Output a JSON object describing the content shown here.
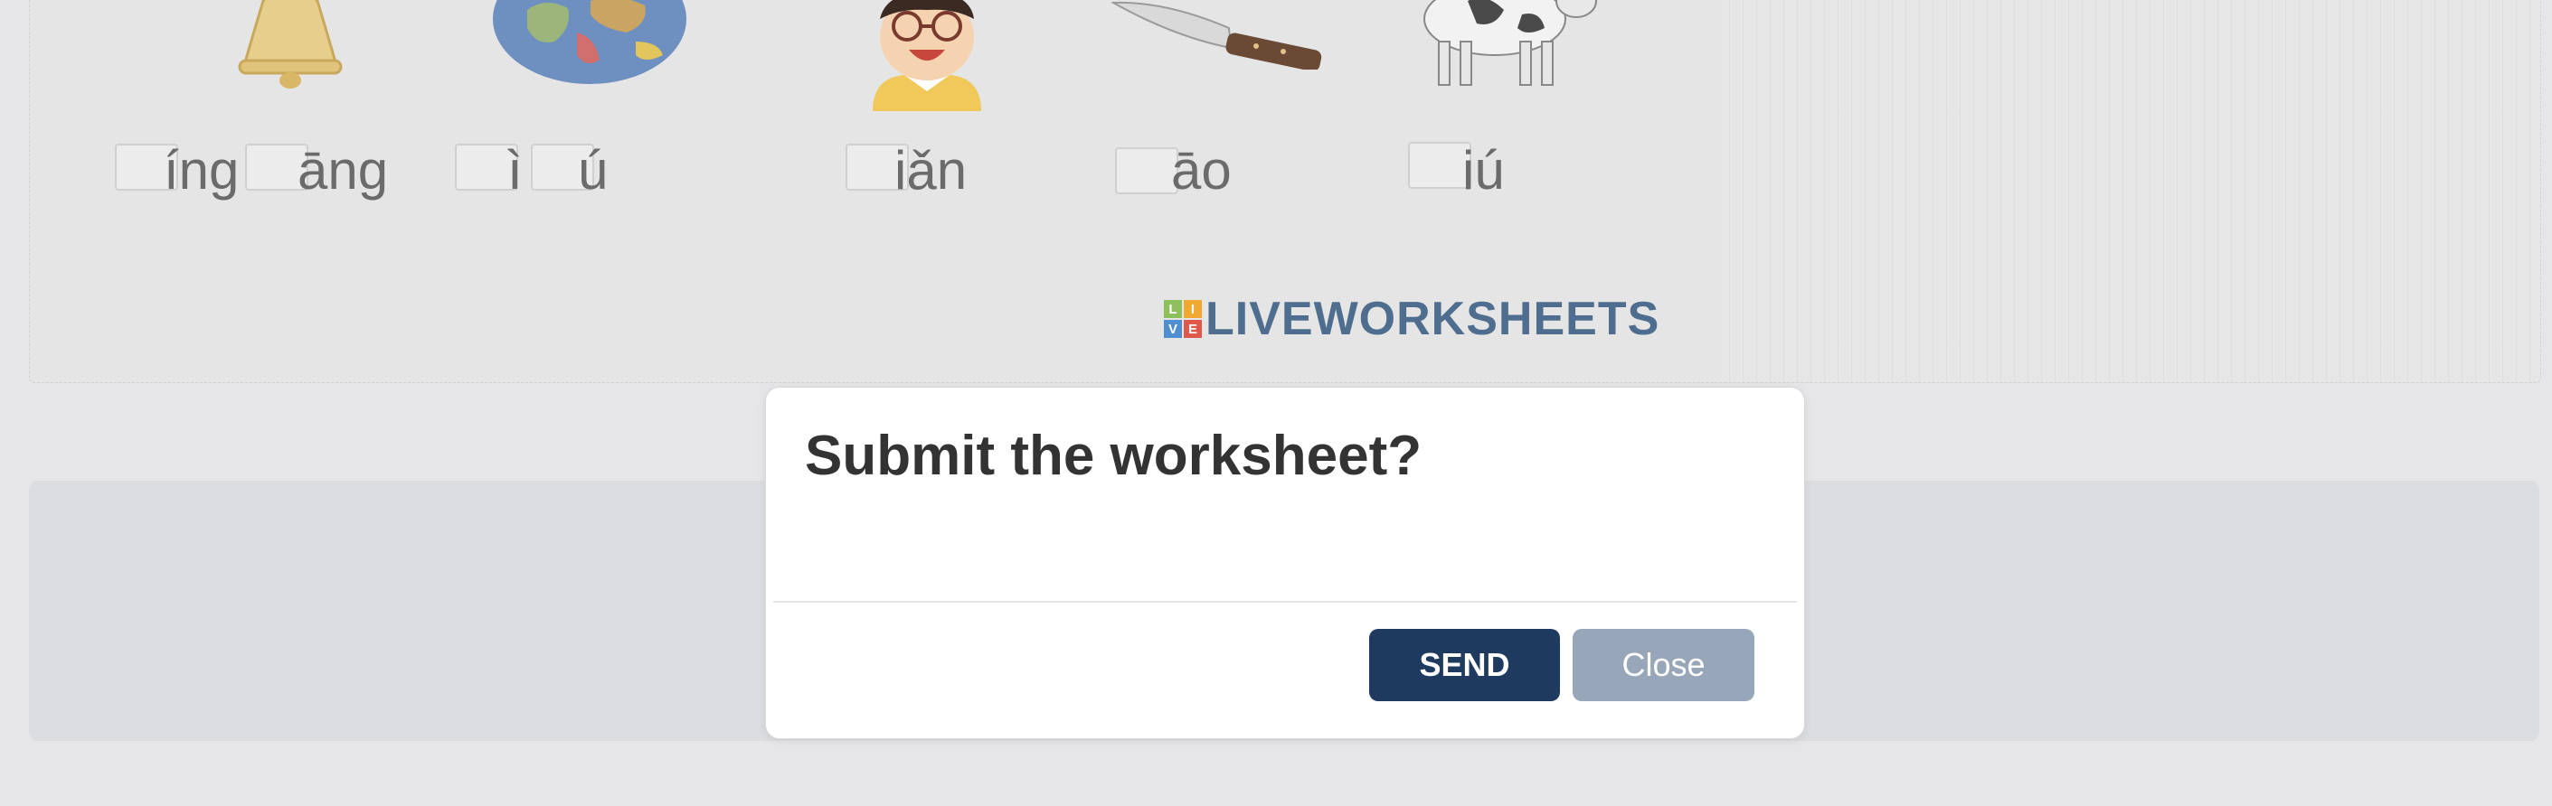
{
  "worksheet": {
    "items": [
      {
        "picture": "bell-picture",
        "syllables": [
          "íng",
          "āng"
        ]
      },
      {
        "picture": "globe-picture",
        "syllables": [
          "ì",
          "ú"
        ]
      },
      {
        "picture": "boy-glasses-picture",
        "syllables": [
          "iǎn"
        ]
      },
      {
        "picture": "knife-picture",
        "syllables": [
          "āo"
        ]
      },
      {
        "picture": "cow-picture",
        "syllables": [
          "iú"
        ]
      }
    ],
    "logo": {
      "letters": [
        "L",
        "I",
        "V",
        "E"
      ],
      "text": "LIVEWORKSHEETS"
    }
  },
  "modal": {
    "title": "Submit the worksheet?",
    "send_label": "SEND",
    "close_label": "Close"
  },
  "colors": {
    "send_button": "#1f3a5f",
    "close_button": "#98a6ba",
    "logo_text": "#4f6d8e",
    "page_background": "#e6e6e8"
  }
}
